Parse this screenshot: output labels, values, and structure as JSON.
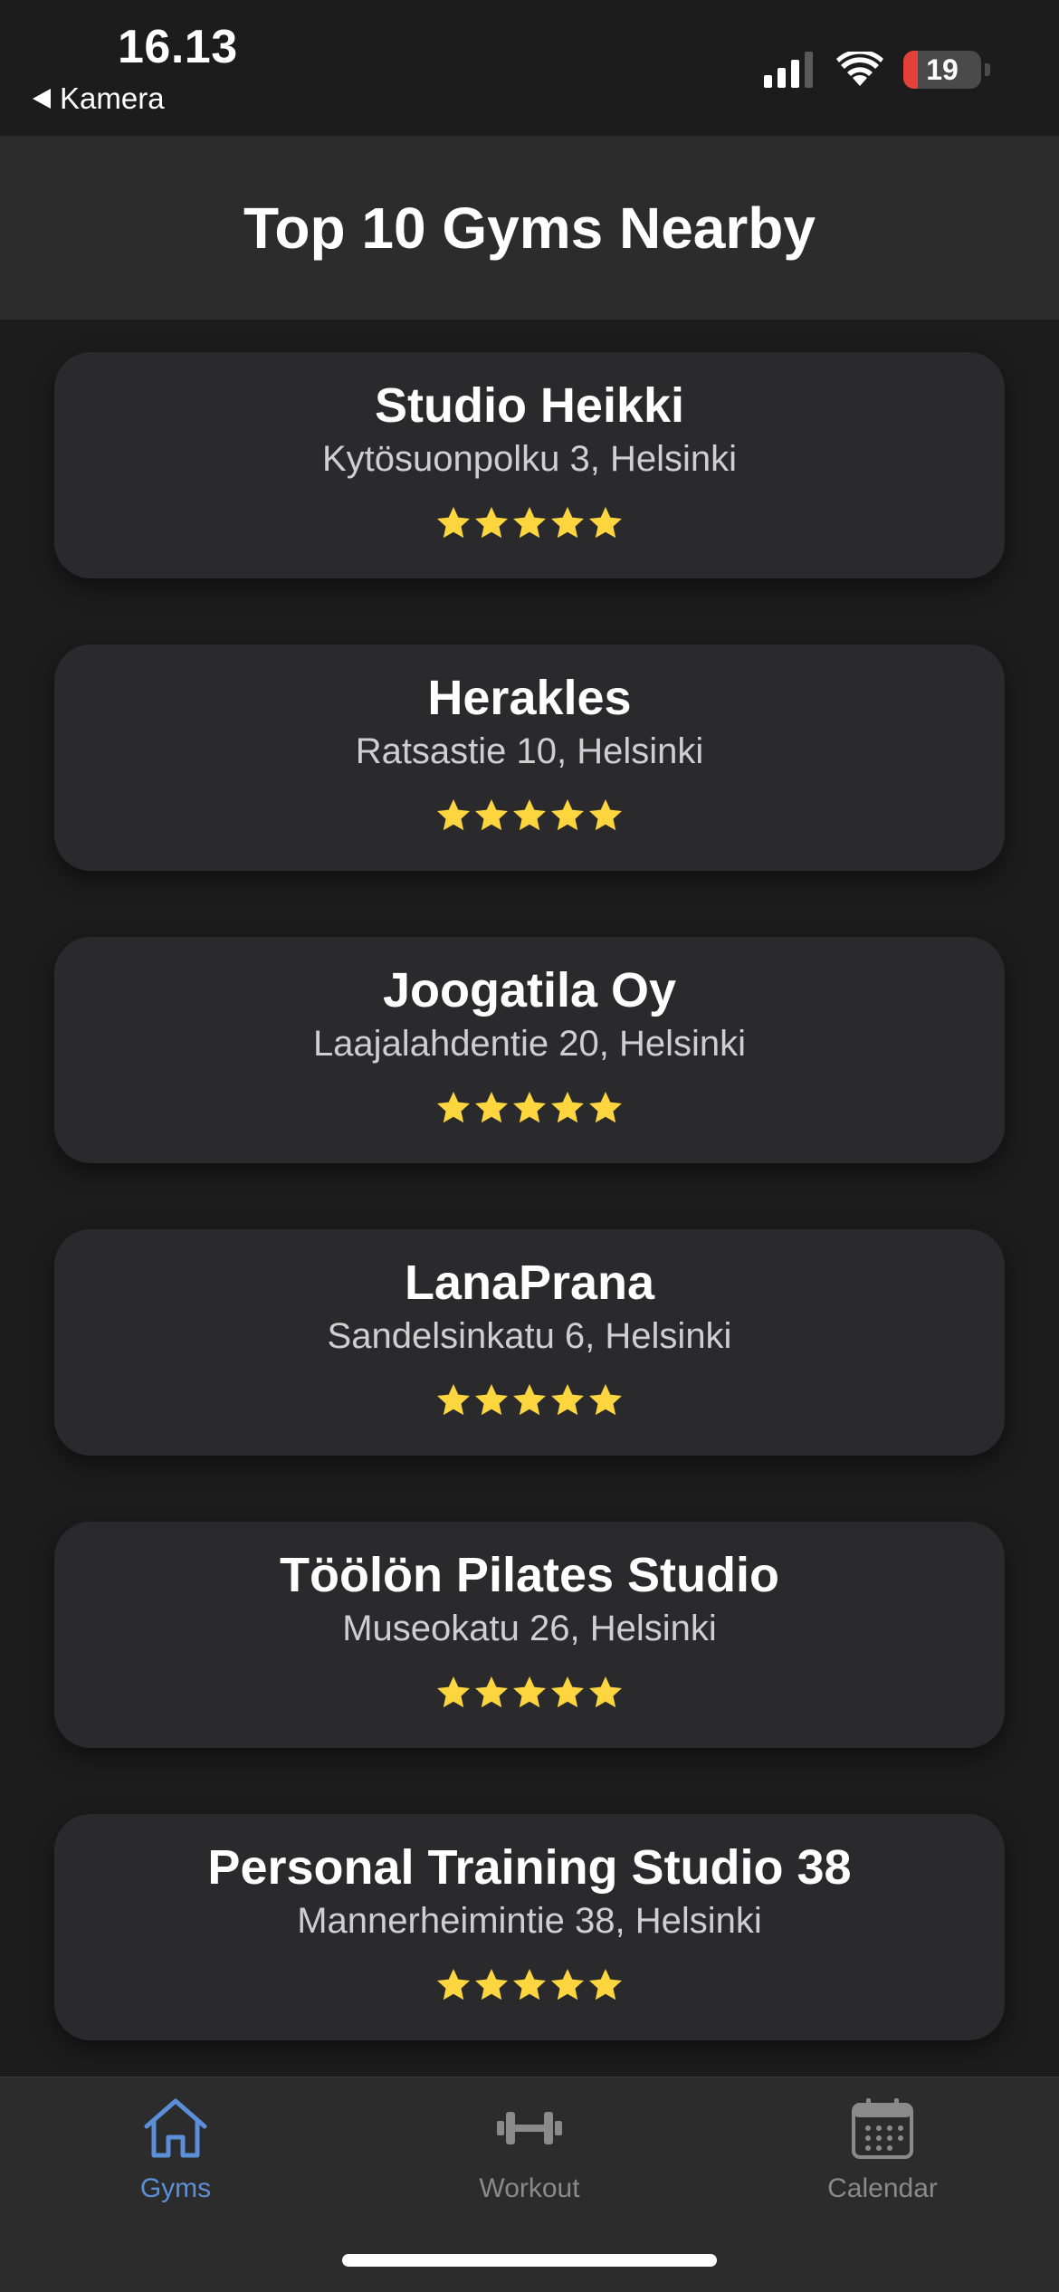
{
  "status_bar": {
    "time": "16.13",
    "back_label": "Kamera",
    "battery_level": "19",
    "battery_fraction": 0.19,
    "icons": [
      "cellular-signal-icon",
      "wifi-icon",
      "battery-icon"
    ]
  },
  "header": {
    "title": "Top 10 Gyms Nearby"
  },
  "gyms": [
    {
      "name": "Studio Heikki",
      "address": "Kytösuonpolku 3, Helsinki",
      "rating": 5
    },
    {
      "name": "Herakles",
      "address": "Ratsastie 10, Helsinki",
      "rating": 5
    },
    {
      "name": "Joogatila Oy",
      "address": "Laajalahdentie 20, Helsinki",
      "rating": 5
    },
    {
      "name": "LanaPrana",
      "address": "Sandelsinkatu 6, Helsinki",
      "rating": 5
    },
    {
      "name": "Töölön Pilates Studio",
      "address": "Museokatu 26, Helsinki",
      "rating": 5
    },
    {
      "name": "Personal Training Studio 38",
      "address": "Mannerheimintie 38, Helsinki",
      "rating": 5
    }
  ],
  "tab_bar": {
    "tabs": [
      {
        "label": "Gyms",
        "icon": "house-icon",
        "active": true
      },
      {
        "label": "Workout",
        "icon": "dumbbell-icon",
        "active": false
      },
      {
        "label": "Calendar",
        "icon": "calendar-icon",
        "active": false
      }
    ]
  },
  "colors": {
    "background": "#1c1c1c",
    "header_bg": "#2c2c2c",
    "card_bg": "#2a2a2c",
    "star": "#fcd53f",
    "tab_active": "#5b8fd9",
    "tab_inactive": "#8a8a8a",
    "battery_low": "#e5403c"
  }
}
